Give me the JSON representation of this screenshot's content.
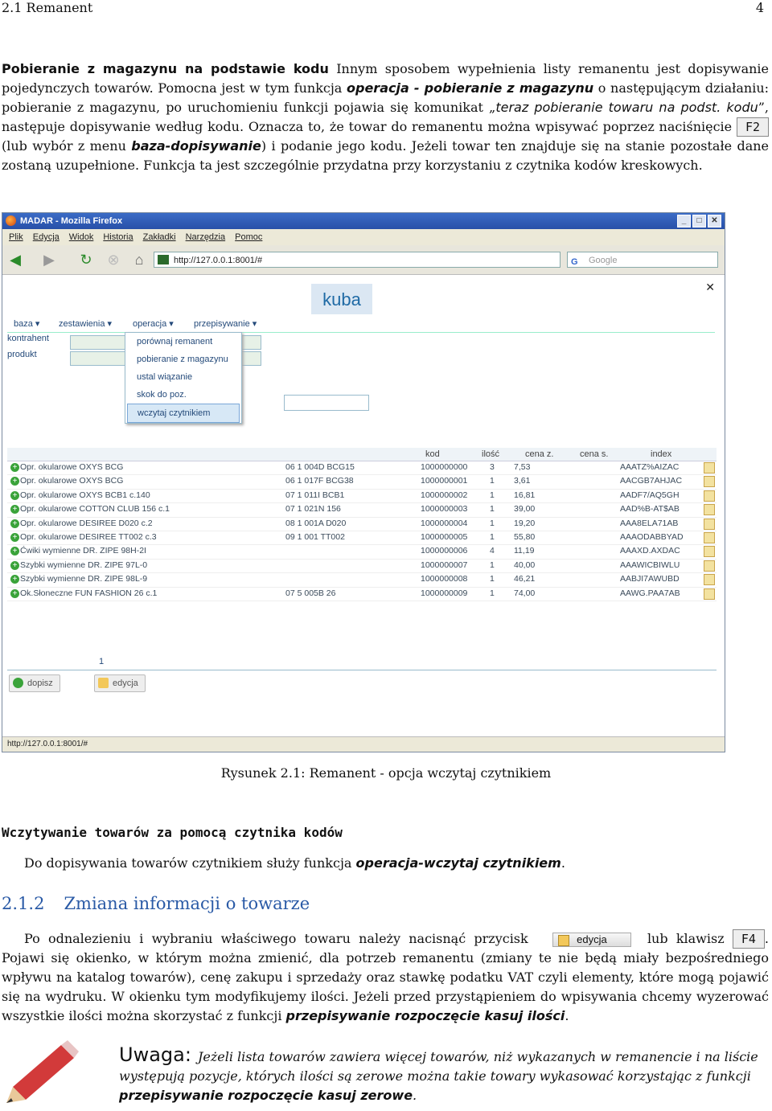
{
  "header": {
    "section": "2.1 Remanent",
    "page": "4"
  },
  "para1": {
    "title": "Pobieranie z magazynu na podstawie kodu",
    "t1": " Innym sposobem wypełnienia listy remanentu jest dopisywanie pojedynczych towarów. Pomocna jest w tym funkcja ",
    "b1": "operacja - pobieranie z magazynu",
    "t2": " o następującym działaniu: pobieranie z magazynu, po uruchomieniu funkcji pojawia się komunikat „",
    "i1": "teraz pobieranie towaru na podst. kodu",
    "t3": "”, następuje dopisywanie według kodu. Oznacza to, że towar do remanentu można wpisywać poprzez naciśnięcie ",
    "key": "F2",
    "t4": " (lub wybór z menu ",
    "b2": "baza-dopisywanie",
    "t5": ") i podanie jego kodu. Jeżeli towar ten znajduje się na stanie pozostałe dane zostaną uzupełnione. Funkcja ta jest szczególnie przydatna przy korzystaniu z czytnika kodów kreskowych."
  },
  "screenshot": {
    "window_title": "MADAR - Mozilla Firefox",
    "menu": [
      "Plik",
      "Edycja",
      "Widok",
      "Historia",
      "Zakładki",
      "Narzędzia",
      "Pomoc"
    ],
    "url": "http://127.0.0.1:8001/#",
    "search_placeholder": "Google",
    "user": "kuba",
    "close": "✕",
    "app_menu": [
      "baza ▾",
      "zestawienia ▾",
      "operacja ▾",
      "przepisywanie ▾"
    ],
    "left_labels": [
      "kontrahent",
      "produkt"
    ],
    "dropdown": [
      "porównaj remanent",
      "pobieranie z magazynu",
      "ustal wiązanie",
      "skok do poz.",
      "wczytaj czytnikiem"
    ],
    "columns": [
      "kod",
      "ilość",
      "cena z.",
      "cena s.",
      "index"
    ],
    "rows": [
      {
        "name": "Opr. okularowe OXYS BCG",
        "code": "06 1 004D BCG15",
        "kod": "1000000000",
        "ilosc": "3",
        "cena": "7,53",
        "index": "AAATZ%AIZAC"
      },
      {
        "name": "Opr. okularowe OXYS BCG",
        "code": "06 1 017F BCG38",
        "kod": "1000000001",
        "ilosc": "1",
        "cena": "3,61",
        "index": "AACGB7AHJAC"
      },
      {
        "name": "Opr. okularowe OXYS BCB1 c.140",
        "code": "07 1 011I BCB1",
        "kod": "1000000002",
        "ilosc": "1",
        "cena": "16,81",
        "index": "AADF7/AQ5GH"
      },
      {
        "name": "Opr. okularowe COTTON CLUB 156 c.1",
        "code": "07 1 021N 156",
        "kod": "1000000003",
        "ilosc": "1",
        "cena": "39,00",
        "index": "AAD%B-AT$AB"
      },
      {
        "name": "Opr. okularowe DESIREE D020 c.2",
        "code": "08 1 001A D020",
        "kod": "1000000004",
        "ilosc": "1",
        "cena": "19,20",
        "index": "AAA8ELA71AB"
      },
      {
        "name": "Opr. okularowe DESIREE TT002 c.3",
        "code": "09 1 001 TT002",
        "kod": "1000000005",
        "ilosc": "1",
        "cena": "55,80",
        "index": "AAAODABBYAD"
      },
      {
        "name": "Ćwiki wymienne DR. ZIPE 98H-2I",
        "code": "",
        "kod": "1000000006",
        "ilosc": "4",
        "cena": "11,19",
        "index": "AAAXD.AXDAC"
      },
      {
        "name": "Szybki wymienne DR. ZIPE 97L-0",
        "code": "",
        "kod": "1000000007",
        "ilosc": "1",
        "cena": "40,00",
        "index": "AAAWICBIWLU"
      },
      {
        "name": "Szybki wymienne DR. ZIPE 98L-9",
        "code": "",
        "kod": "1000000008",
        "ilosc": "1",
        "cena": "46,21",
        "index": "AABJI7AWUBD"
      },
      {
        "name": "Ok.Słoneczne FUN FASHION 26 c.1",
        "code": "07 5 005B 26",
        "kod": "1000000009",
        "ilosc": "1",
        "cena": "74,00",
        "index": "AAWG.PAA7AB"
      }
    ],
    "pager": "1",
    "btn_add": "dopisz",
    "btn_edit": "edycja",
    "status": "http://127.0.0.1:8001/#"
  },
  "caption": "Rysunek 2.1: Remanent - opcja wczytaj czytnikiem",
  "h_reader": "Wczytywanie towarów za pomocą czytnika kodów",
  "para2": {
    "t1": "Do dopisywania towarów czytnikiem służy funkcja ",
    "b1": "operacja-wczytaj czytnikiem",
    "t2": "."
  },
  "section": {
    "num": "2.1.2",
    "title": "Zmiana informacji o towarze"
  },
  "para3": {
    "t1": "Po odnalezieniu i wybraniu właściwego towaru należy nacisnąć przycisk ",
    "btn": "edycja",
    "t2": "lub klawisz ",
    "key": "F4",
    "t3": ". Pojawi się okienko, w którym można zmienić, dla potrzeb remanentu (zmiany te nie będą miały bezpośredniego wpływu na katalog towarów), cenę zakupu i sprzedaży oraz stawkę podatku VAT czyli elementy, które mogą pojawić się na wydruku. W okienku tym modyfikujemy ilości. Jeżeli przed przystąpieniem do wpisywania chcemy wyzerować wszystkie ilości można skorzystać z funkcji ",
    "b1": "przepisywanie rozpoczęcie kasuj ilości",
    "t4": "."
  },
  "note": {
    "label": "Uwaga:",
    "t1": "Jeżeli lista towarów zawiera więcej towarów, niż wykazanych w remanencie i na liście występują pozycje, których ilości są zerowe można takie towary wykasować korzystając z funkcji ",
    "b1": "przepisywanie rozpoczęcie kasuj zerowe",
    "t2": "."
  }
}
